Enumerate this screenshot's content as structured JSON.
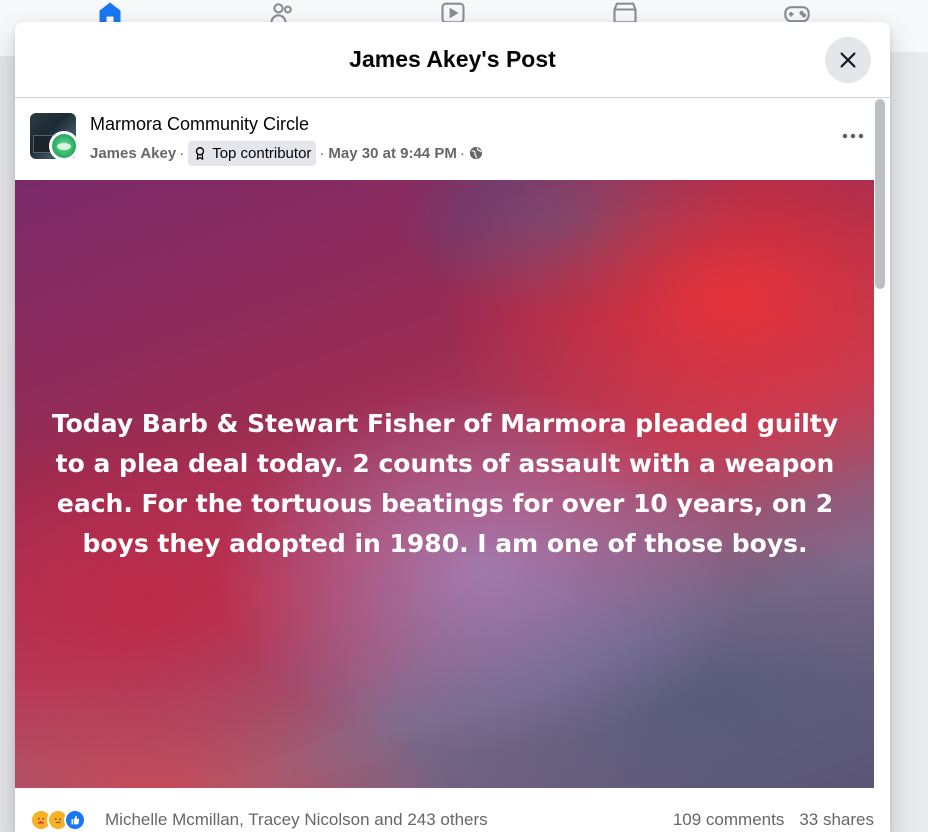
{
  "modal": {
    "title": "James Akey's Post"
  },
  "post": {
    "group_name": "Marmora Community Circle",
    "author": "James Akey",
    "separator": "·",
    "badge": "Top contributor",
    "timestamp": "May 30 at 9:44 PM",
    "audience_icon": "globe-icon",
    "text": "Today Barb & Stewart Fisher of Marmora pleaded guilty to a plea deal today. 2 counts of assault with a weapon each. For the tortuous beatings for over 10 years, on 2 boys they adopted in 1980. I am one of those boys.",
    "background_colors": [
      "#7a2a6a",
      "#e83237",
      "#b54060",
      "#5f5474"
    ]
  },
  "stats": {
    "reaction_icons": [
      "care-icon",
      "sad-icon",
      "like-icon"
    ],
    "reactors": "Michelle Mcmillan, Tracey Nicolson and 243 others",
    "comments": "109 comments",
    "shares": "33 shares"
  },
  "nav": {
    "icons": [
      "home-icon",
      "friends-icon",
      "video-icon",
      "marketplace-icon",
      "gaming-icon"
    ]
  },
  "colors": {
    "accent": "#1877f2",
    "secondary_text": "#65676b",
    "badge_bg": "#e4e6eb"
  }
}
